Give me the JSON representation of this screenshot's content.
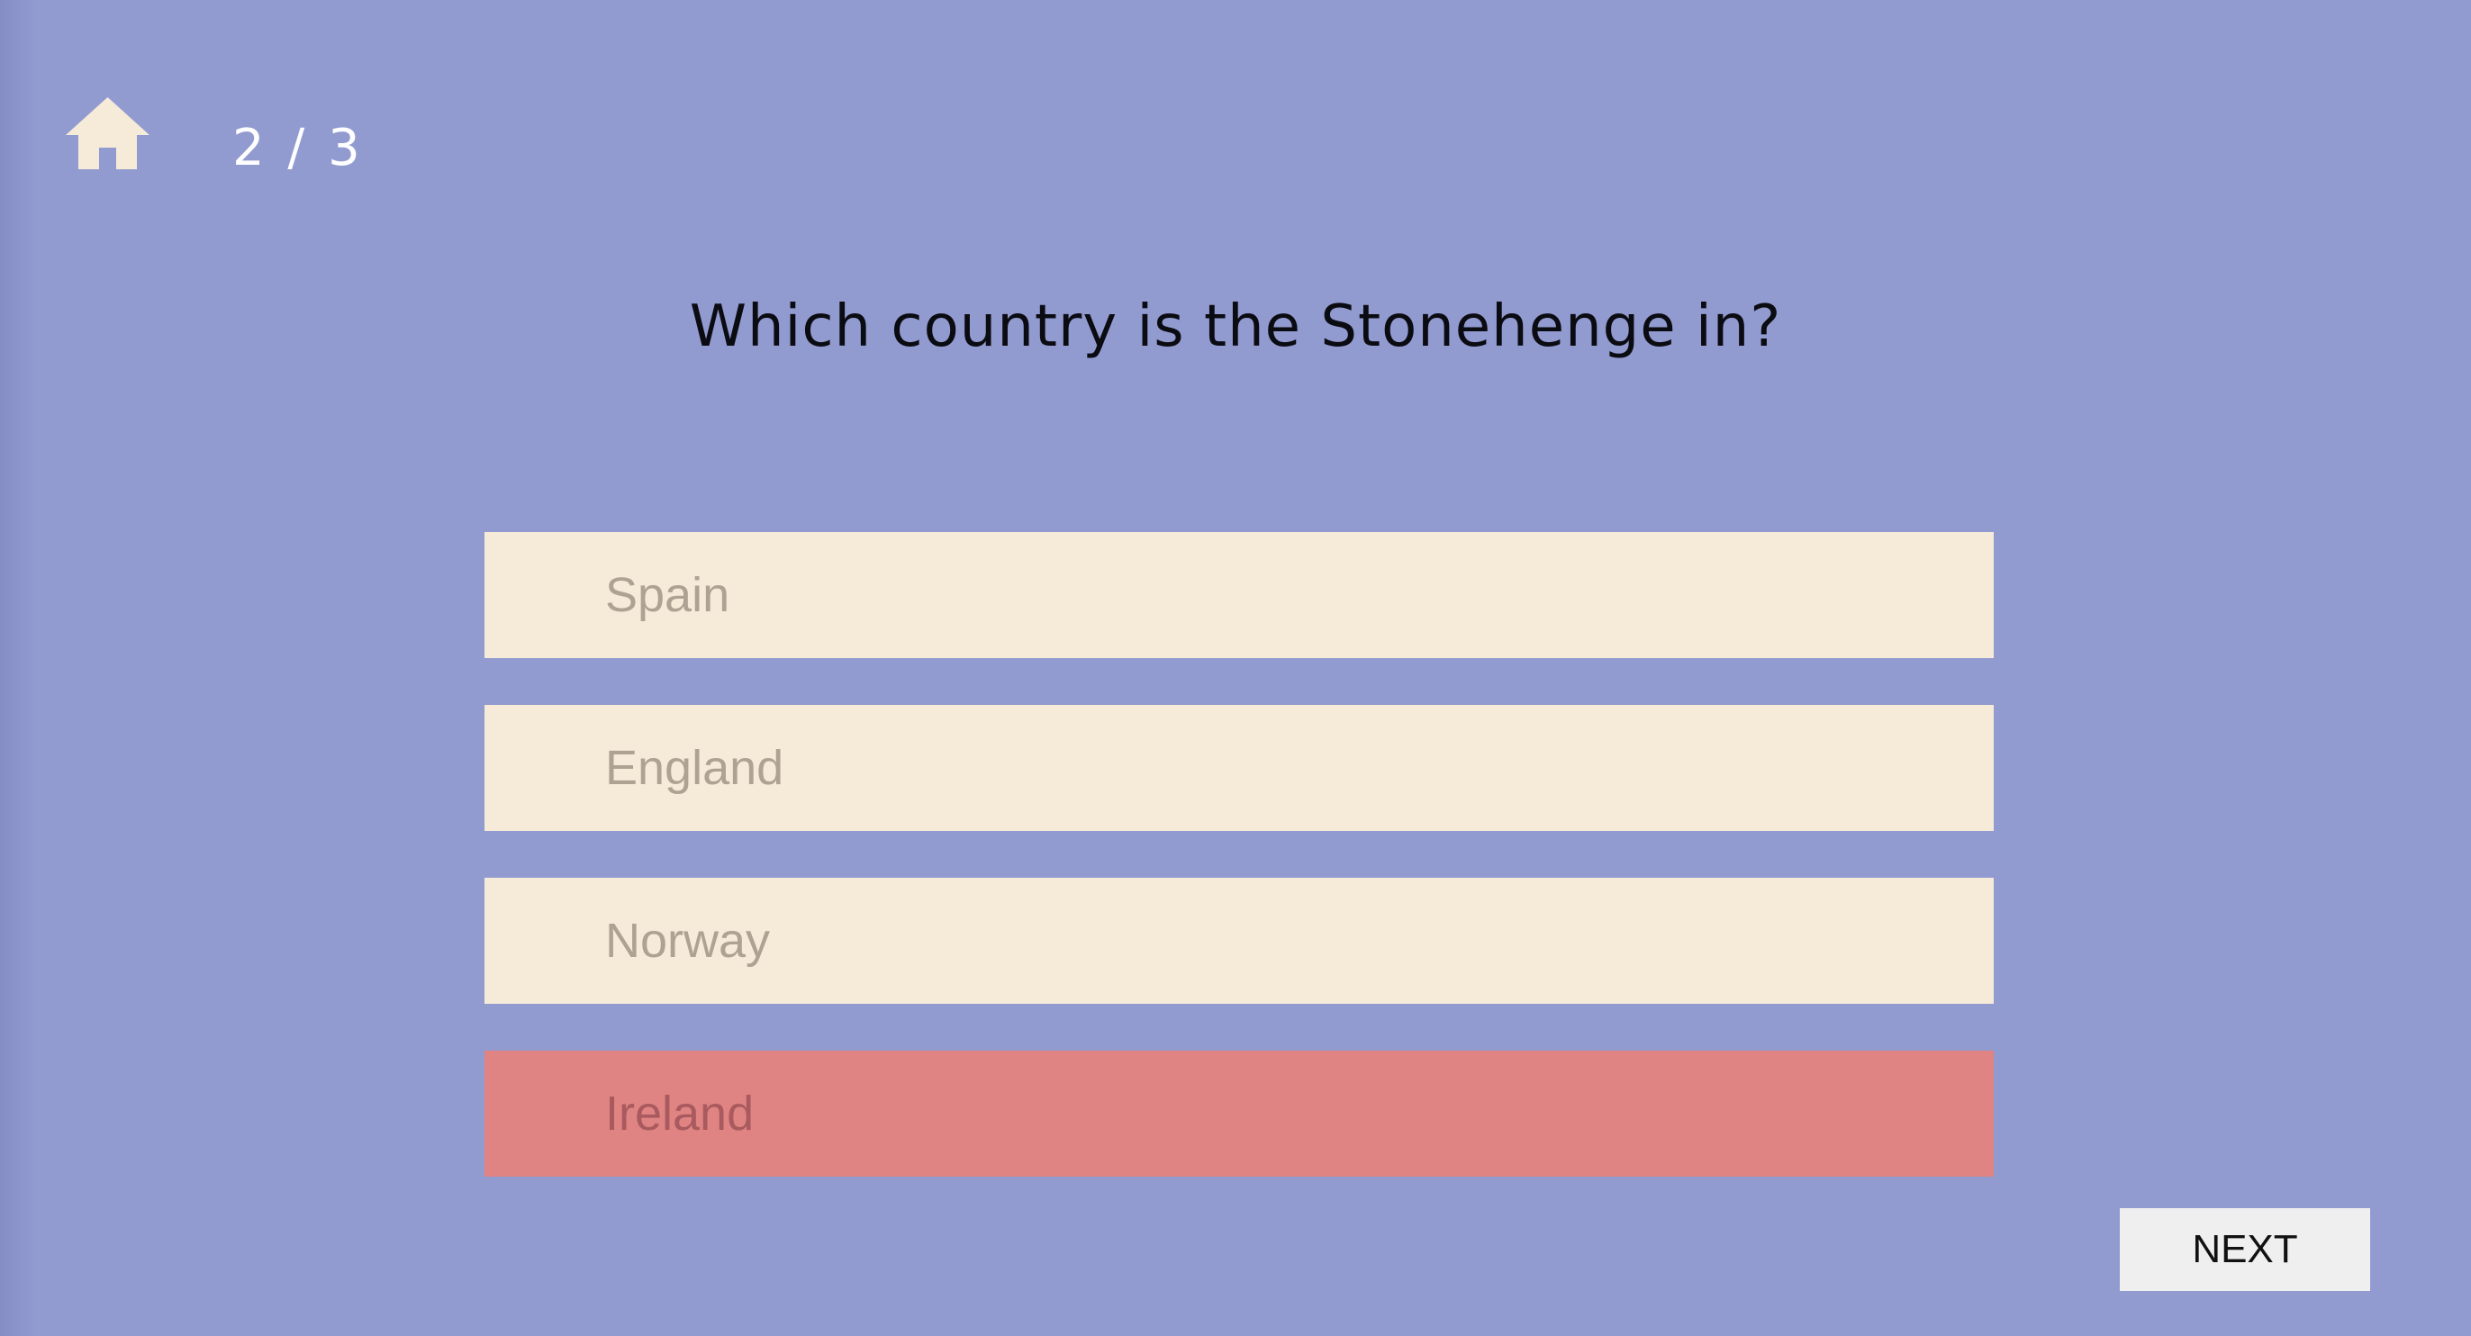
{
  "nav": {
    "home_icon": "home-icon",
    "progress": "2 / 3"
  },
  "question": {
    "text": "Which country is the Stonehenge in?"
  },
  "answers": [
    {
      "label": "Spain",
      "state": "default"
    },
    {
      "label": "England",
      "state": "default"
    },
    {
      "label": "Norway",
      "state": "default"
    },
    {
      "label": "Ireland",
      "state": "wrong"
    }
  ],
  "controls": {
    "next_label": "NEXT"
  },
  "colors": {
    "background": "#929bd0",
    "answer_default": "#f6ebd9",
    "answer_wrong": "#e08483",
    "home_icon": "#f6ebd9",
    "next_button": "#efefef"
  }
}
